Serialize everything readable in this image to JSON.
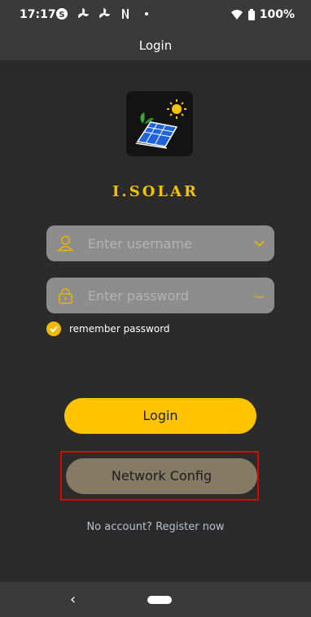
{
  "status_bar": {
    "time": "17:17",
    "left_icons": [
      "skype-icon",
      "fan-icon",
      "fan-icon",
      "netflix-icon",
      "dot-icon"
    ],
    "battery": "100%"
  },
  "header": {
    "title": "Login"
  },
  "app": {
    "name": "I.SOLAR"
  },
  "form": {
    "username_placeholder": "Enter username",
    "password_placeholder": "Enter password",
    "remember_label": "remember password"
  },
  "buttons": {
    "login": "Login",
    "network_config": "Network Config"
  },
  "links": {
    "register": "No account? Register now"
  },
  "colors": {
    "accent": "#ffc300",
    "app_name": "#f2c400",
    "network_button": "#857a63",
    "highlight": "#e10000",
    "background": "#2b2b2b"
  }
}
